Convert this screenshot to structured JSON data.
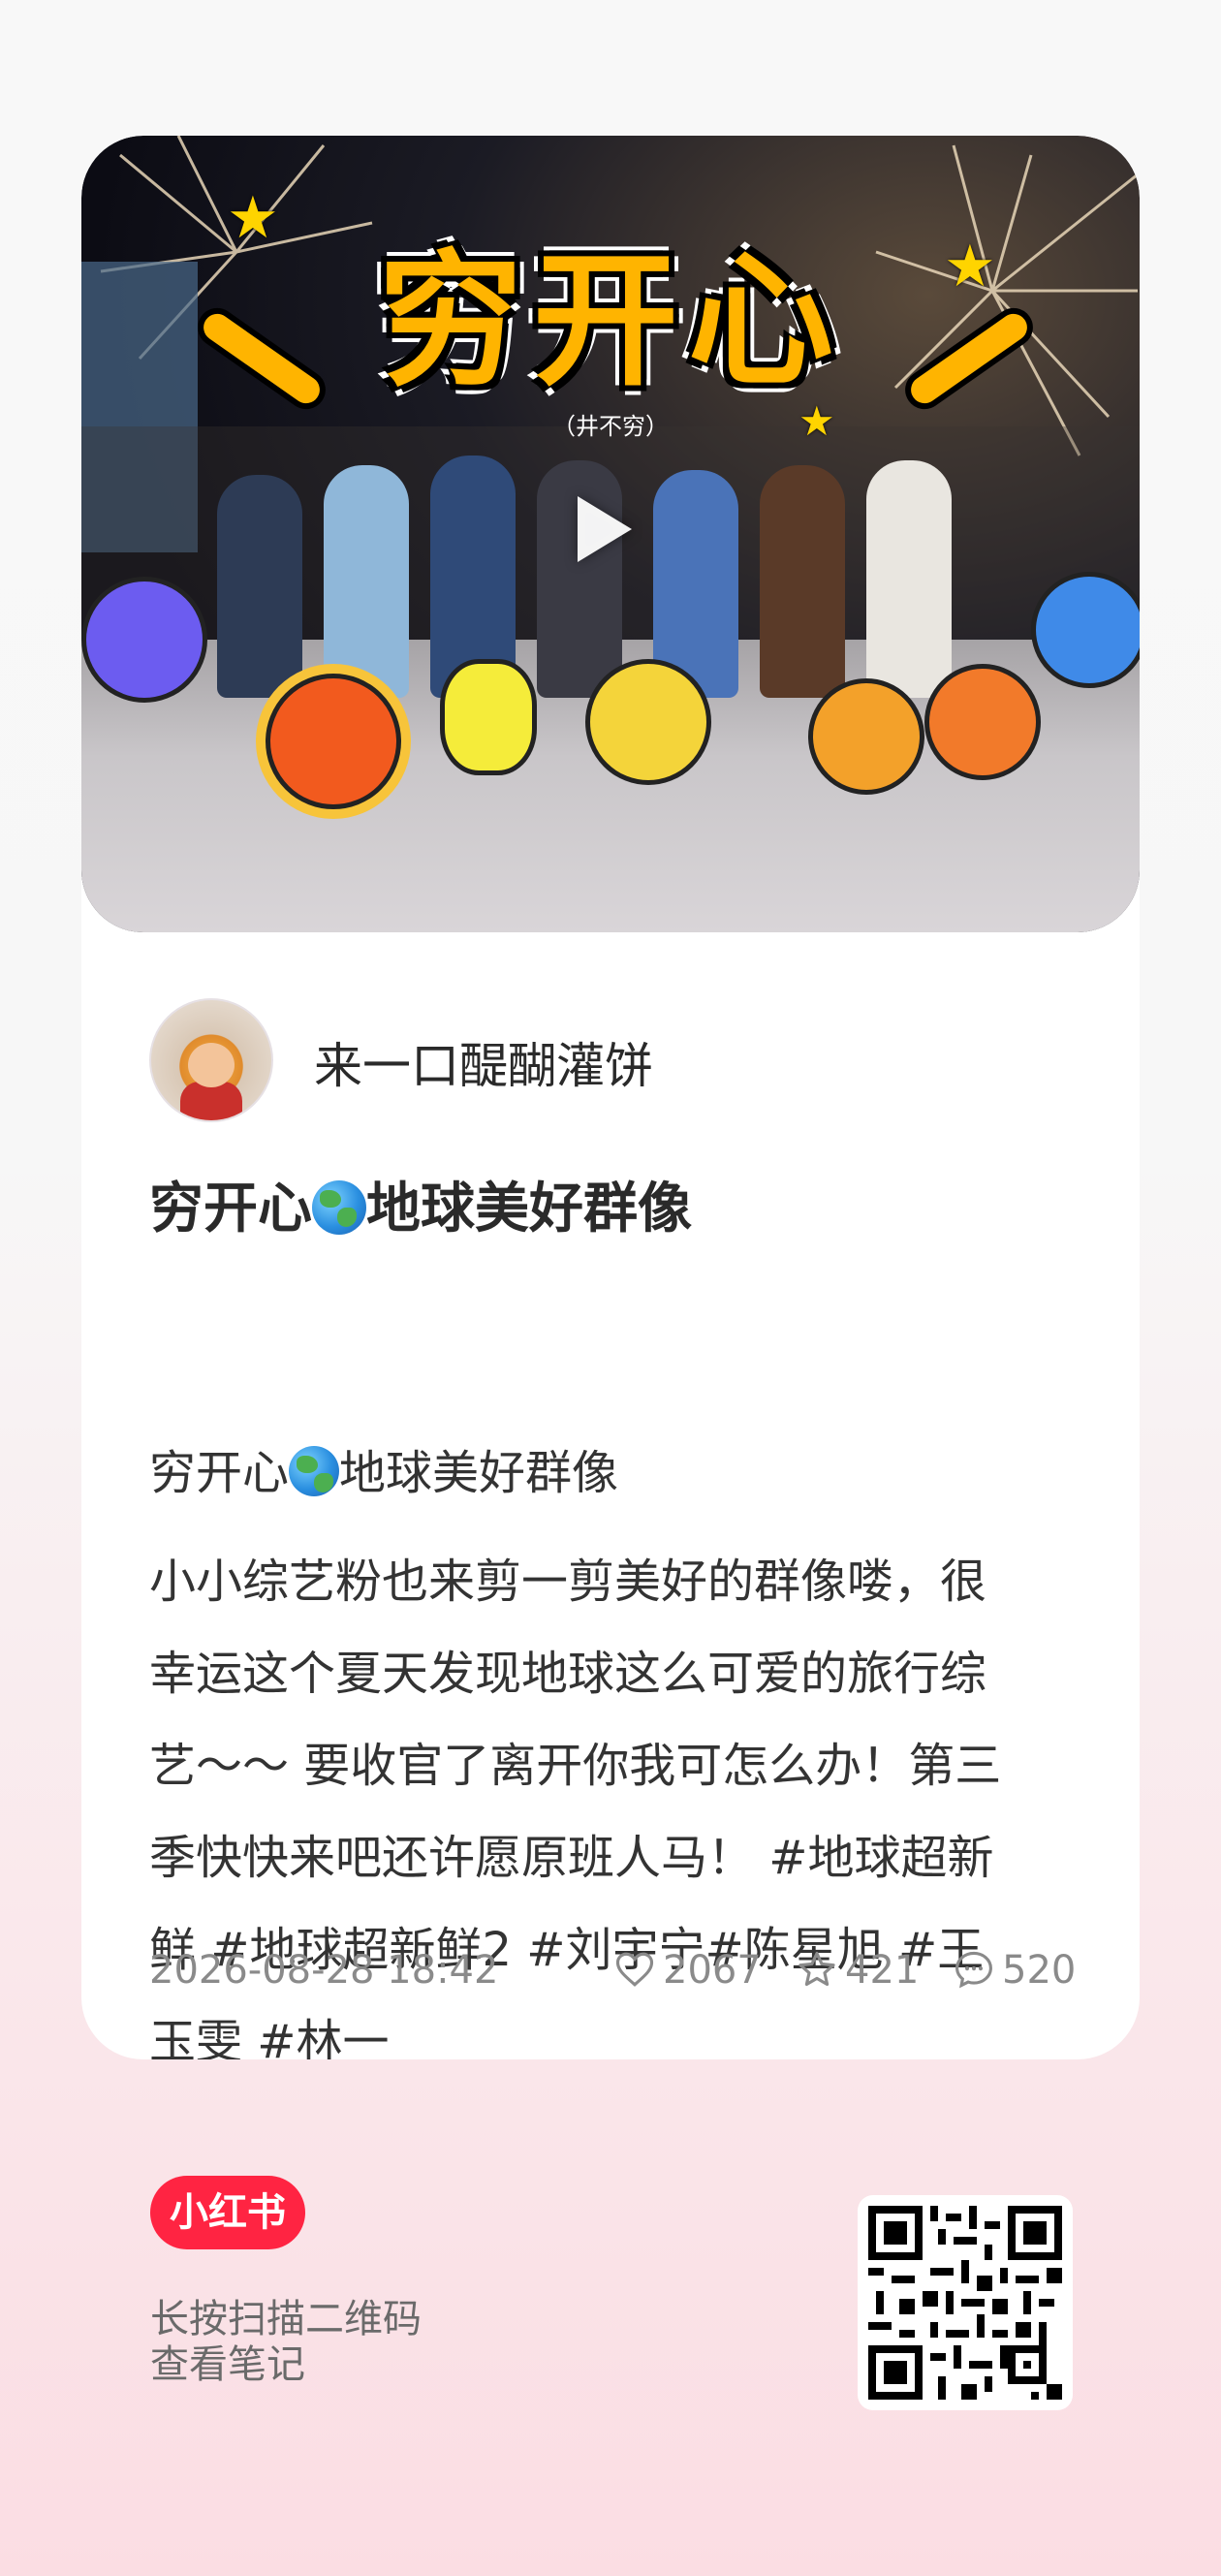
{
  "cover": {
    "title": "穷开心",
    "subtitle": "（井不穷）"
  },
  "author": {
    "name": "来一口醍醐灌饼"
  },
  "post": {
    "title_prefix": "穷开心",
    "title_suffix": "地球美好群像",
    "body_first_prefix": "穷开心",
    "body_first_suffix": "地球美好群像",
    "body": "小小综艺粉也来剪一剪美好的群像喽，很\n幸运这个夏天发现地球这么可爱的旅行综\n艺～～ 要收官了离开你我可怎么办！第三\n季快快来吧还许愿原班人马！ #地球超新\n鲜 #地球超新鲜2 #刘宇宁#陈星旭 #王\n玉雯 #林一"
  },
  "meta": {
    "date": "2026-08-28 18:42",
    "likes": "2067",
    "collects": "421",
    "comments": "520"
  },
  "footer": {
    "logo_text": "小红书",
    "scan_line1": "长按扫描二维码",
    "scan_line2": "查看笔记"
  },
  "colors": {
    "brand": "#ff2442",
    "accent_yellow": "#ffb400"
  }
}
